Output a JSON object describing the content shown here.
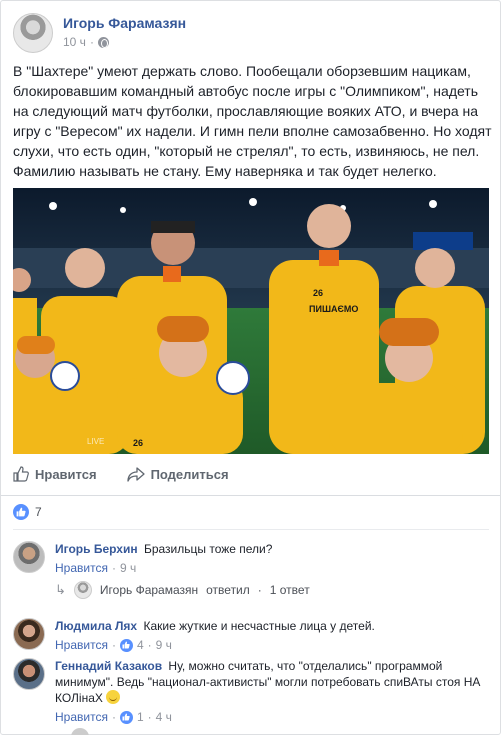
{
  "post": {
    "author": "Игорь Фарамазян",
    "time": "10 ч",
    "separator": "·",
    "text": "В \"Шахтере\" умеют держать слово. Пообещали оборзевшим нацикам, блокировавшим командный автобус после игры с \"Олимпиком\", надеть на следующий матч футболки, прославляющие вояких АТО, и вчера на игру с \"Вересом\" их надели. И гимн пели вполне самозабвенно. Но ходят слухи, что есть один, \"который не стрелял\", то есть, извиняюсь, не пел. Фамилию называть не стану. Ему наверняка и так будет нелегко.",
    "photo": {
      "shirt_number_1": "26",
      "shirt_text": "ПИШАЄМО",
      "shirt_number_2": "26",
      "tv_logo": "LIVE"
    }
  },
  "actions": {
    "like_label": "Нравится",
    "share_label": "Поделиться"
  },
  "likes": {
    "count": "7"
  },
  "comments": [
    {
      "author": "Игорь Берхин",
      "text": "Бразильцы тоже пели?",
      "like_link": "Нравится",
      "time": "9 ч",
      "reply": {
        "author": "Игорь Фарамазян",
        "action": "ответил",
        "count_text": "1 ответ"
      }
    },
    {
      "author": "Людмила Лях",
      "text": "Какие жуткие и несчастные лица у детей.",
      "like_link": "Нравится",
      "like_count": "4",
      "time": "9 ч"
    },
    {
      "author": "Геннадий Казаков",
      "text": "Ну, можно считать, что \"отделались\" программой минимум\". Ведь \"национал-активисты\" могли потребовать спиВАты стоя НА КОЛінаХ",
      "like_link": "Нравится",
      "like_count": "1",
      "time": "4 ч"
    }
  ],
  "colors": {
    "link": "#365899",
    "accent": "#4267b2",
    "like_blue": "#5890ff",
    "shirt_yellow": "#f2b819"
  }
}
